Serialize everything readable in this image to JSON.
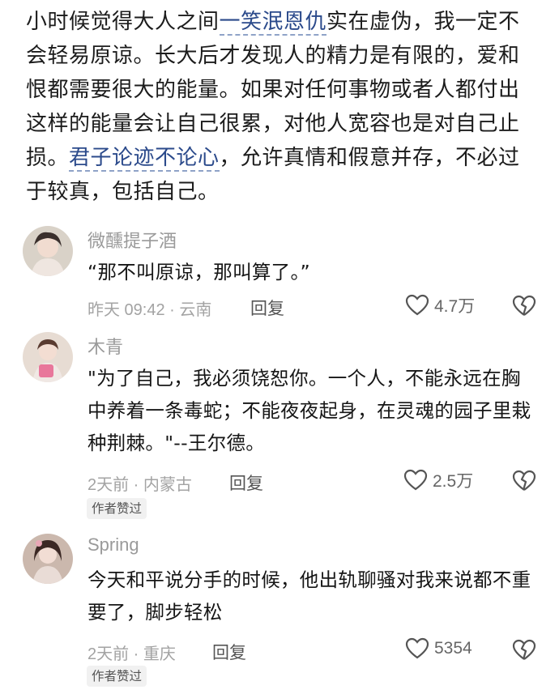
{
  "post": {
    "text_before": "小时候觉得大人之间",
    "link1": "一笑泯恩仇",
    "text_mid": "实在虚伪，我一定不会轻易原谅。长大后才发现人的精力是有限的，爱和恨都需要很大的能量。如果对任何事物或者人都付出这样的能量会让自己很累，对他人宽容也是对自己止损。",
    "link2": "君子论迹不论心",
    "text_after": "，允许真情和假意并存，不必过于较真，包括自己。"
  },
  "comments": [
    {
      "username": "微醺提子酒",
      "text": "“那不叫原谅，那叫算了。”",
      "meta": "昨天 09:42 · 云南",
      "reply": "回复",
      "likes": "4.7万",
      "avatar_icon": "user-avatar"
    },
    {
      "username": "木青",
      "text": "\"为了自己，我必须饶恕你。一个人，不能永远在胸中养着一条毒蛇；不能夜夜起身，在灵魂的园子里栽种荆棘。\"--王尔德。",
      "meta": "2天前 · 内蒙古",
      "reply": "回复",
      "likes": "2.5万",
      "badge": "作者赞过",
      "avatar_icon": "user-avatar"
    },
    {
      "username": "Spring",
      "text": "今天和平说分手的时候，他出轨聊骚对我来说都不重要了，脚步轻松",
      "meta": "2天前 · 重庆",
      "reply": "回复",
      "likes": "5354",
      "badge": "作者赞过",
      "avatar_icon": "user-avatar"
    }
  ],
  "icons": {
    "like": "heart-outline-icon",
    "dislike": "broken-heart-icon"
  },
  "colors": {
    "link": "#2b4a8b",
    "meta": "#a3a3a3",
    "username": "#9a9a9a"
  }
}
